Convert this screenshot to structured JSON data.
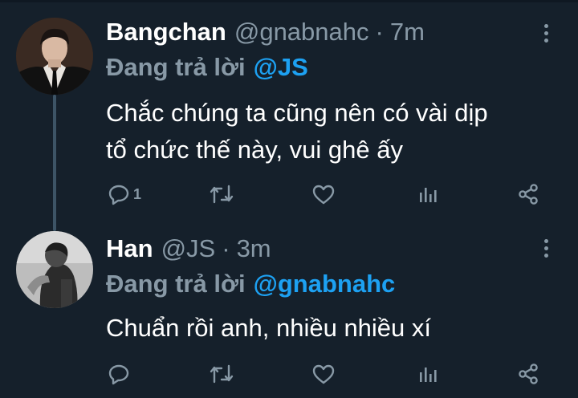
{
  "tweets": [
    {
      "name": "Bangchan",
      "handle": "@gnabnahc",
      "separator": "·",
      "time": "7m",
      "reply_prefix": "Đang trả lời",
      "reply_to": "@JS",
      "text_line1": "Chắc chúng ta cũng nên có vài dịp",
      "text_line2": "tổ chức thế này, vui ghê ấy",
      "reply_count": "1"
    },
    {
      "name": "Han",
      "handle": "@JS",
      "separator": "·",
      "time": "3m",
      "reply_prefix": "Đang trả lời",
      "reply_to": "@gnabnahc",
      "text_line1": "Chuẩn rồi anh, nhiều nhiều xí",
      "reply_count": ""
    }
  ],
  "icons": {
    "reply": "reply-icon",
    "retweet": "retweet-icon",
    "like": "heart-icon",
    "analytics": "analytics-icon",
    "share": "share-icon",
    "more": "more-vertical-icon"
  },
  "colors": {
    "background": "#15202b",
    "muted": "#8899a6",
    "mention": "#1da1f2",
    "thread_line": "#3d5466"
  }
}
